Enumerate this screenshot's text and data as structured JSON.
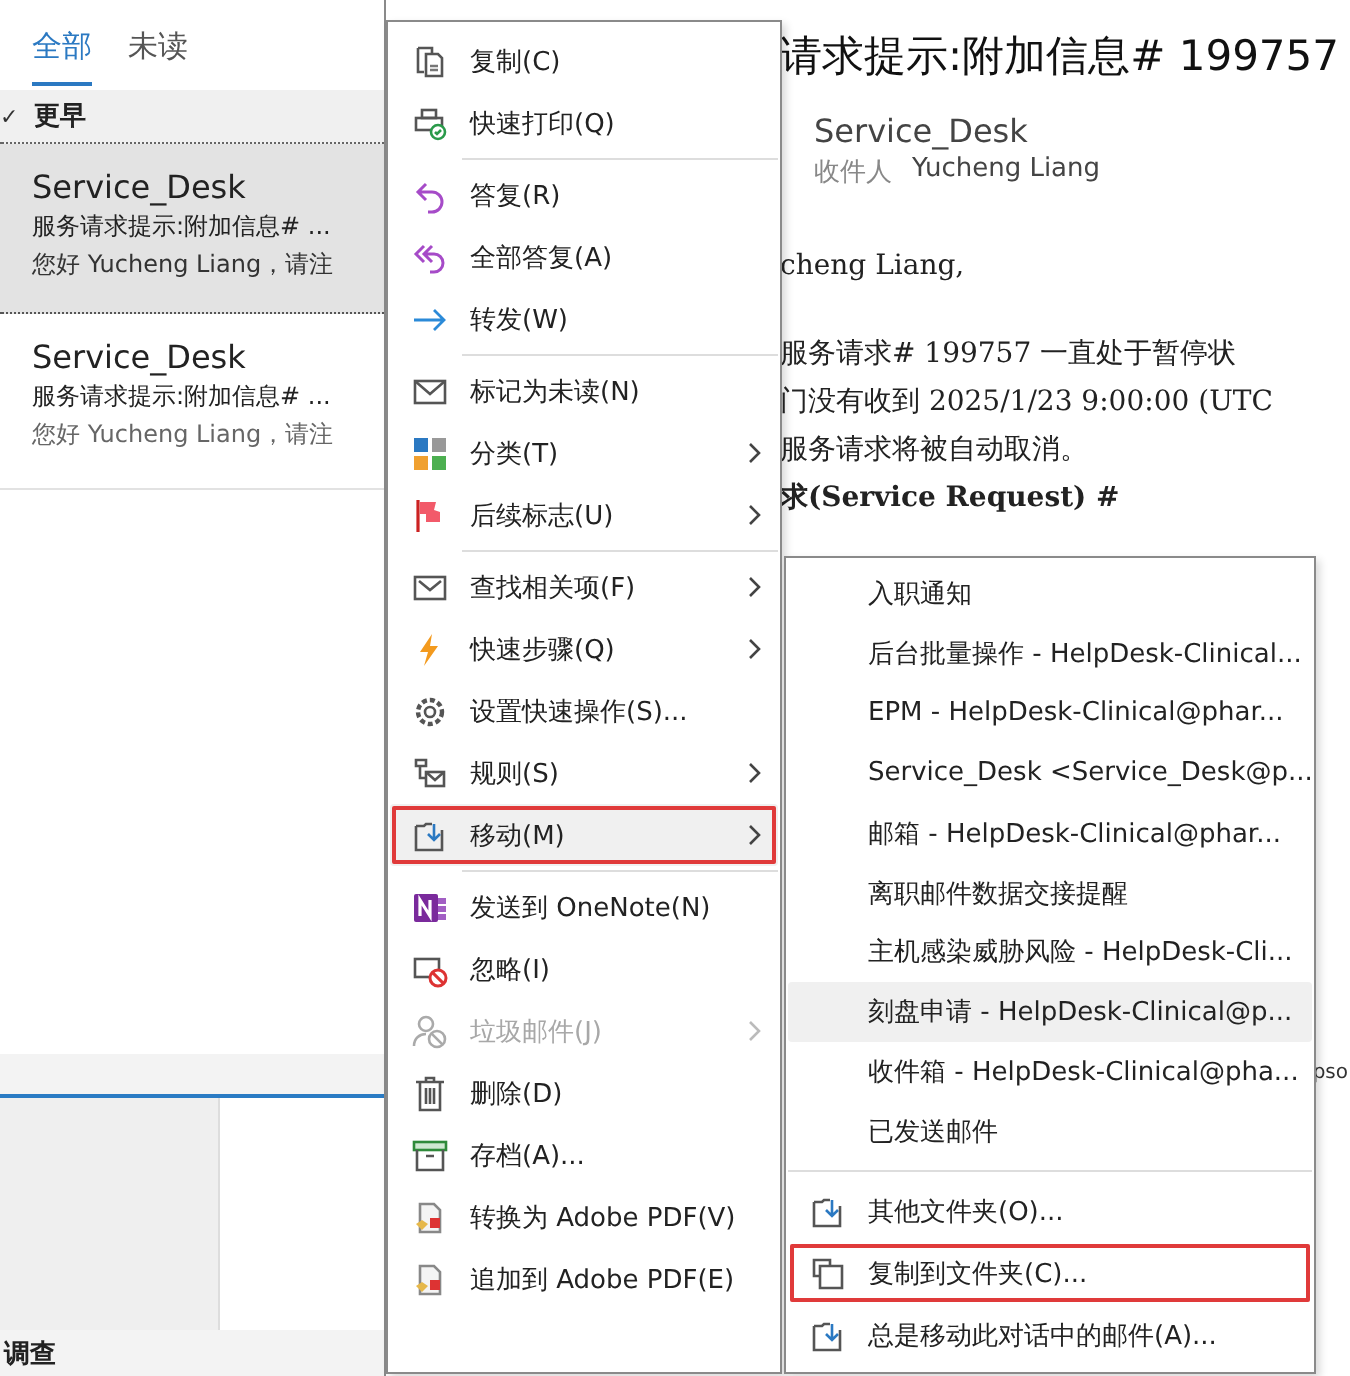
{
  "mail_list": {
    "tabs": [
      {
        "label": "全部",
        "selected": true
      },
      {
        "label": "未读",
        "selected": false
      }
    ],
    "group": {
      "check": "✓",
      "label": "更早",
      "expanded": true
    },
    "messages": [
      {
        "sender": "Service_Desk",
        "subject": "服务请求提示:附加信息# ...",
        "preview": "您好 Yucheng Liang，请注",
        "selected": true
      },
      {
        "sender": "Service_Desk",
        "subject": "服务请求提示:附加信息# ...",
        "preview": "您好 Yucheng Liang，请注",
        "selected": false
      }
    ],
    "footer_label": "调查"
  },
  "reading_pane": {
    "subject": "请求提示:附加信息# 199757",
    "sender": "Service_Desk",
    "to_label": "收件人",
    "to": "Yucheng Liang",
    "body": [
      {
        "text": "cheng Liang,",
        "bold": false
      },
      {
        "text": "服务请求# 199757 一直处于暂停状",
        "bold": false
      },
      {
        "text": "门没有收到 2025/1/23 9:00:00 (UTC",
        "bold": false
      },
      {
        "text": "服务请求将被自动取消。",
        "bold": false
      },
      {
        "text": "求(Service Request) #",
        "bold": true
      }
    ],
    "tab_fragment": "pso"
  },
  "context_menu": {
    "items": [
      {
        "kind": "item",
        "label": "复制(C)",
        "submenu": false,
        "disabled": false,
        "highlighted": false,
        "outlined": false
      },
      {
        "kind": "item",
        "label": "快速打印(Q)",
        "submenu": false,
        "disabled": false,
        "highlighted": false,
        "outlined": false
      },
      {
        "kind": "separator"
      },
      {
        "kind": "item",
        "label": "答复(R)",
        "submenu": false,
        "disabled": false,
        "highlighted": false,
        "outlined": false
      },
      {
        "kind": "item",
        "label": "全部答复(A)",
        "submenu": false,
        "disabled": false,
        "highlighted": false,
        "outlined": false
      },
      {
        "kind": "item",
        "label": "转发(W)",
        "submenu": false,
        "disabled": false,
        "highlighted": false,
        "outlined": false
      },
      {
        "kind": "separator"
      },
      {
        "kind": "item",
        "label": "标记为未读(N)",
        "submenu": false,
        "disabled": false,
        "highlighted": false,
        "outlined": false
      },
      {
        "kind": "item",
        "label": "分类(T)",
        "submenu": true,
        "disabled": false,
        "highlighted": false,
        "outlined": false
      },
      {
        "kind": "item",
        "label": "后续标志(U)",
        "submenu": true,
        "disabled": false,
        "highlighted": false,
        "outlined": false
      },
      {
        "kind": "separator"
      },
      {
        "kind": "item",
        "label": "查找相关项(F)",
        "submenu": true,
        "disabled": false,
        "highlighted": false,
        "outlined": false
      },
      {
        "kind": "item",
        "label": "快速步骤(Q)",
        "submenu": true,
        "disabled": false,
        "highlighted": false,
        "outlined": false
      },
      {
        "kind": "item",
        "label": "设置快速操作(S)...",
        "submenu": false,
        "disabled": false,
        "highlighted": false,
        "outlined": false
      },
      {
        "kind": "item",
        "label": "规则(S)",
        "submenu": true,
        "disabled": false,
        "highlighted": false,
        "outlined": false
      },
      {
        "kind": "item",
        "label": "移动(M)",
        "submenu": true,
        "disabled": false,
        "highlighted": true,
        "outlined": true
      },
      {
        "kind": "separator"
      },
      {
        "kind": "item",
        "label": "发送到 OneNote(N)",
        "submenu": false,
        "disabled": false,
        "highlighted": false,
        "outlined": false
      },
      {
        "kind": "item",
        "label": "忽略(I)",
        "submenu": false,
        "disabled": false,
        "highlighted": false,
        "outlined": false
      },
      {
        "kind": "item",
        "label": "垃圾邮件(J)",
        "submenu": true,
        "disabled": true,
        "highlighted": false,
        "outlined": false
      },
      {
        "kind": "item",
        "label": "删除(D)",
        "submenu": false,
        "disabled": false,
        "highlighted": false,
        "outlined": false
      },
      {
        "kind": "item",
        "label": "存档(A)...",
        "submenu": false,
        "disabled": false,
        "highlighted": false,
        "outlined": false
      },
      {
        "kind": "item",
        "label": "转换为 Adobe PDF(V)",
        "submenu": false,
        "disabled": false,
        "highlighted": false,
        "outlined": false
      },
      {
        "kind": "item",
        "label": "追加到 Adobe PDF(E)",
        "submenu": false,
        "disabled": false,
        "highlighted": false,
        "outlined": false
      }
    ]
  },
  "move_submenu": {
    "items": [
      {
        "kind": "folder",
        "label": "入职通知",
        "highlighted": false,
        "outlined": false
      },
      {
        "kind": "folder",
        "label": "后台批量操作 - HelpDesk-Clinical...",
        "highlighted": false,
        "outlined": false
      },
      {
        "kind": "folder",
        "label": "EPM - HelpDesk-Clinical@phar...",
        "highlighted": false,
        "outlined": false
      },
      {
        "kind": "folder",
        "label": "Service_Desk <Service_Desk@p...",
        "highlighted": false,
        "outlined": false
      },
      {
        "kind": "folder",
        "label": "邮箱 - HelpDesk-Clinical@phar...",
        "highlighted": false,
        "outlined": false
      },
      {
        "kind": "folder",
        "label": "离职邮件数据交接提醒",
        "highlighted": false,
        "outlined": false
      },
      {
        "kind": "folder",
        "label": "主机感染威胁风险 - HelpDesk-Cli...",
        "highlighted": false,
        "outlined": false
      },
      {
        "kind": "folder",
        "label": "刻盘申请 - HelpDesk-Clinical@p...",
        "highlighted": true,
        "outlined": false
      },
      {
        "kind": "folder",
        "label": "收件箱 - HelpDesk-Clinical@pha...",
        "highlighted": false,
        "outlined": false
      },
      {
        "kind": "folder",
        "label": "已发送邮件",
        "highlighted": false,
        "outlined": false
      },
      {
        "kind": "separator"
      },
      {
        "kind": "action",
        "label": "其他文件夹(O)...",
        "highlighted": false,
        "outlined": false
      },
      {
        "kind": "action",
        "label": "复制到文件夹(C)...",
        "highlighted": false,
        "outlined": true
      },
      {
        "kind": "action",
        "label": "总是移动此对话中的邮件(A)...",
        "highlighted": false,
        "outlined": false
      }
    ]
  }
}
